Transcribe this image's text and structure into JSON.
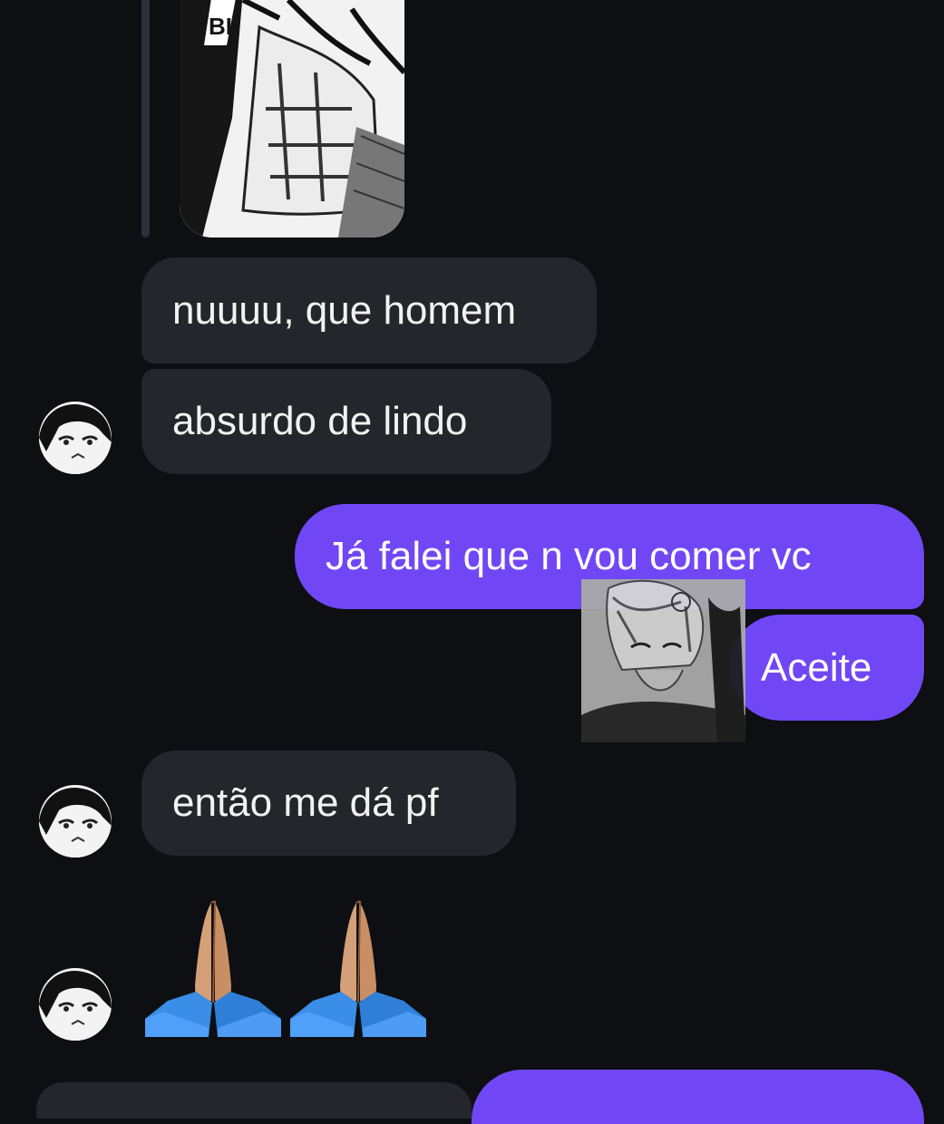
{
  "messages": [
    {
      "id": "m1",
      "direction": "incoming",
      "text": "nuuuu, que homem"
    },
    {
      "id": "m2",
      "direction": "incoming",
      "text": "absurdo de lindo"
    },
    {
      "id": "m3",
      "direction": "outgoing",
      "text": "Já falei que n vou comer vc"
    },
    {
      "id": "m4",
      "direction": "outgoing",
      "text": "Aceite"
    },
    {
      "id": "m5",
      "direction": "incoming",
      "text": "então me dá pf"
    }
  ],
  "reaction_emoji": [
    "🙏",
    "🙏"
  ],
  "colors": {
    "background": "#0d0f13",
    "incoming_bubble": "#24262b",
    "outgoing_bubble": "#7147f5",
    "quote_bar": "#2d3037"
  },
  "icons": {
    "quoted_image": "manga-image",
    "sticker": "anime-sticker",
    "avatar": "contact-avatar",
    "reaction": "folded-hands-emoji"
  }
}
